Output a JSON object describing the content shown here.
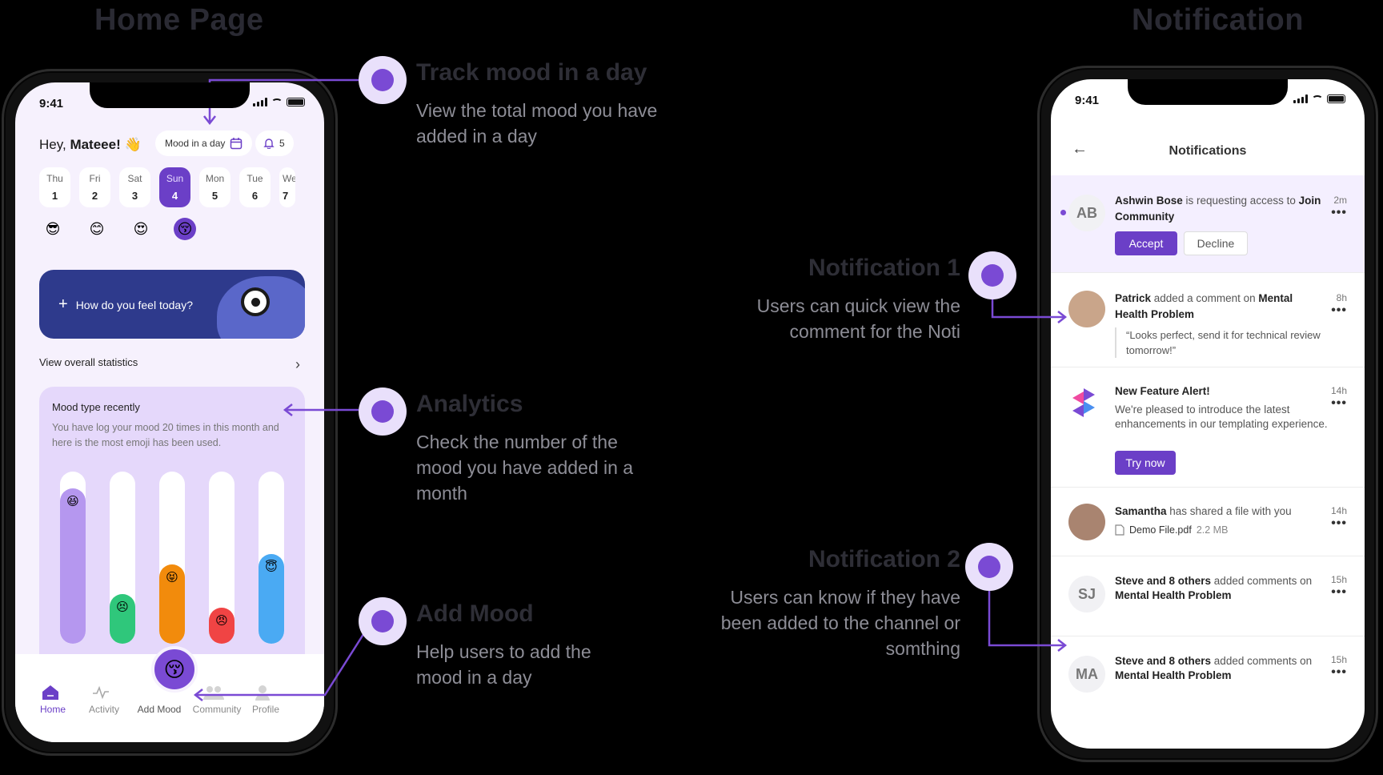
{
  "titles": {
    "home": "Home Page",
    "notification": "Notification"
  },
  "status": {
    "time": "9:41"
  },
  "home": {
    "greeting_prefix": "Hey,",
    "greeting_name": "Mateee!",
    "greeting_emoji": "👋",
    "mood_day_label": "Mood in a day",
    "bell_count": "5",
    "days": [
      {
        "name": "Thu",
        "num": "1",
        "emoji": "😎"
      },
      {
        "name": "Fri",
        "num": "2",
        "emoji": "😊"
      },
      {
        "name": "Sat",
        "num": "3",
        "emoji": "😍"
      },
      {
        "name": "Sun",
        "num": "4",
        "emoji": "😚"
      },
      {
        "name": "Mon",
        "num": "5"
      },
      {
        "name": "Tue",
        "num": "6"
      },
      {
        "name": "We",
        "num": "7"
      }
    ],
    "feel_prompt": "How do you feel today?",
    "stats_link": "View overall statistics",
    "mood_card_title": "Mood type recently",
    "mood_card_desc": "You have log your mood 20 times in this month and here is the most emoji has been used.",
    "mood_bars": [
      {
        "level": 0.9,
        "color": "#b597ef",
        "emoji": "😆"
      },
      {
        "level": 0.29,
        "color": "#2fc77b",
        "emoji": "😣"
      },
      {
        "level": 0.46,
        "color": "#f28b0c",
        "emoji": "😝"
      },
      {
        "level": 0.21,
        "color": "#f04444",
        "emoji": "😠"
      },
      {
        "level": 0.52,
        "color": "#4aaaf3",
        "emoji": "😇"
      }
    ],
    "tabs": [
      "Home",
      "Activity",
      "Add Mood",
      "Community",
      "Profile"
    ],
    "add_emoji": "😚"
  },
  "notif": {
    "header": "Notifications",
    "items": [
      {
        "initials": "AB",
        "name": "Ashwin Bose",
        "text": " is requesting access to ",
        "target": "Join Community",
        "time": "2m",
        "accept": "Accept",
        "decline": "Decline"
      },
      {
        "name": "Patrick",
        "text": " added a comment on ",
        "target": "Mental Health Problem",
        "time": "8h",
        "quote": "“Looks perfect, send it for technical review tomorrow!”"
      },
      {
        "title": "New Feature Alert!",
        "time": "14h",
        "desc": "We're pleased to introduce the latest enhancements in our templating experience.",
        "cta": "Try now"
      },
      {
        "name": "Samantha",
        "text": " has shared a file with you",
        "time": "14h",
        "file": "Demo File.pdf",
        "size": "2.2 MB"
      },
      {
        "initials": "SJ",
        "name": "Steve and 8 others",
        "text": " added comments on ",
        "target": "Mental Health Problem",
        "time": "15h"
      },
      {
        "initials": "MA",
        "name": "Steve and 8 others",
        "text": " added comments on ",
        "target": "Mental Health Problem",
        "time": "15h"
      }
    ]
  },
  "annotations": [
    {
      "title": "Track mood in a day",
      "desc": "View the total mood you have added in a day"
    },
    {
      "title": "Analytics",
      "desc": "Check the number of the mood you have added in a month"
    },
    {
      "title": "Add Mood",
      "desc": "Help users to add the mood in a day"
    },
    {
      "title": "Notification 1",
      "desc": "Users can quick view the comment for the Noti"
    },
    {
      "title": "Notification 2",
      "desc": "Users can know if they have been added to the channel or somthing"
    }
  ],
  "colors": {
    "accent": "#7a4ad4",
    "primary": "#6b3fc7",
    "banner": "#2e3a8c"
  }
}
